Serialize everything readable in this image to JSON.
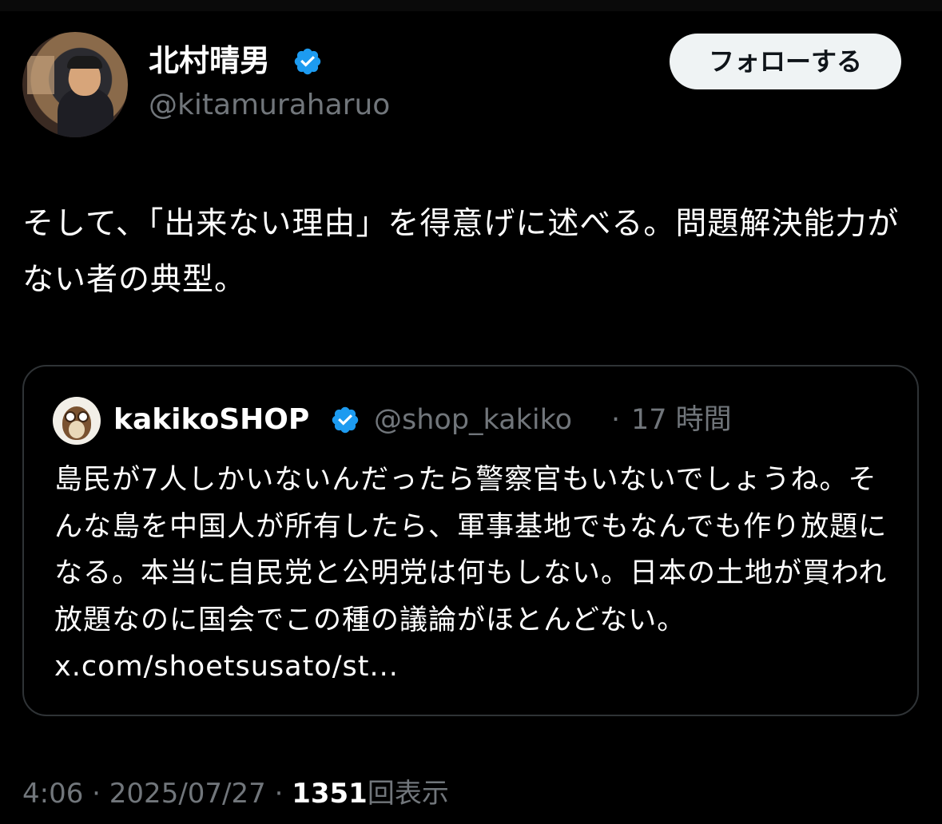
{
  "author": {
    "name": "北村晴男",
    "handle": "@kitamuraharuo",
    "verified_color": "#1d9bf0"
  },
  "follow_button": {
    "label": "フォローする"
  },
  "tweet": {
    "text": "そして、「出来ない理由」を得意げに述べる。問題解決能力がない者の典型。"
  },
  "quote": {
    "name": "kakikoSHOP",
    "handle": "@shop_kakiko",
    "separator": "·",
    "time": "17 時間",
    "text": "島民が7人しかいないんだったら警察官もいないでしょうね。そんな島を中国人が所有したら、軍事基地でもなんでも作り放題になる。本当に自民党と公明党は何もしない。日本の土地が買われ放題なのに国会でこの種の議論がほとんどない。",
    "link": "x.com/shoetsusato/st..."
  },
  "meta": {
    "time": "4:06",
    "sep1": "·",
    "date": "2025/07/27",
    "sep2": "·",
    "views": "1351",
    "views_label": "回表示"
  },
  "icons": [
    "verified-badge-icon",
    "owl-avatar-icon"
  ]
}
